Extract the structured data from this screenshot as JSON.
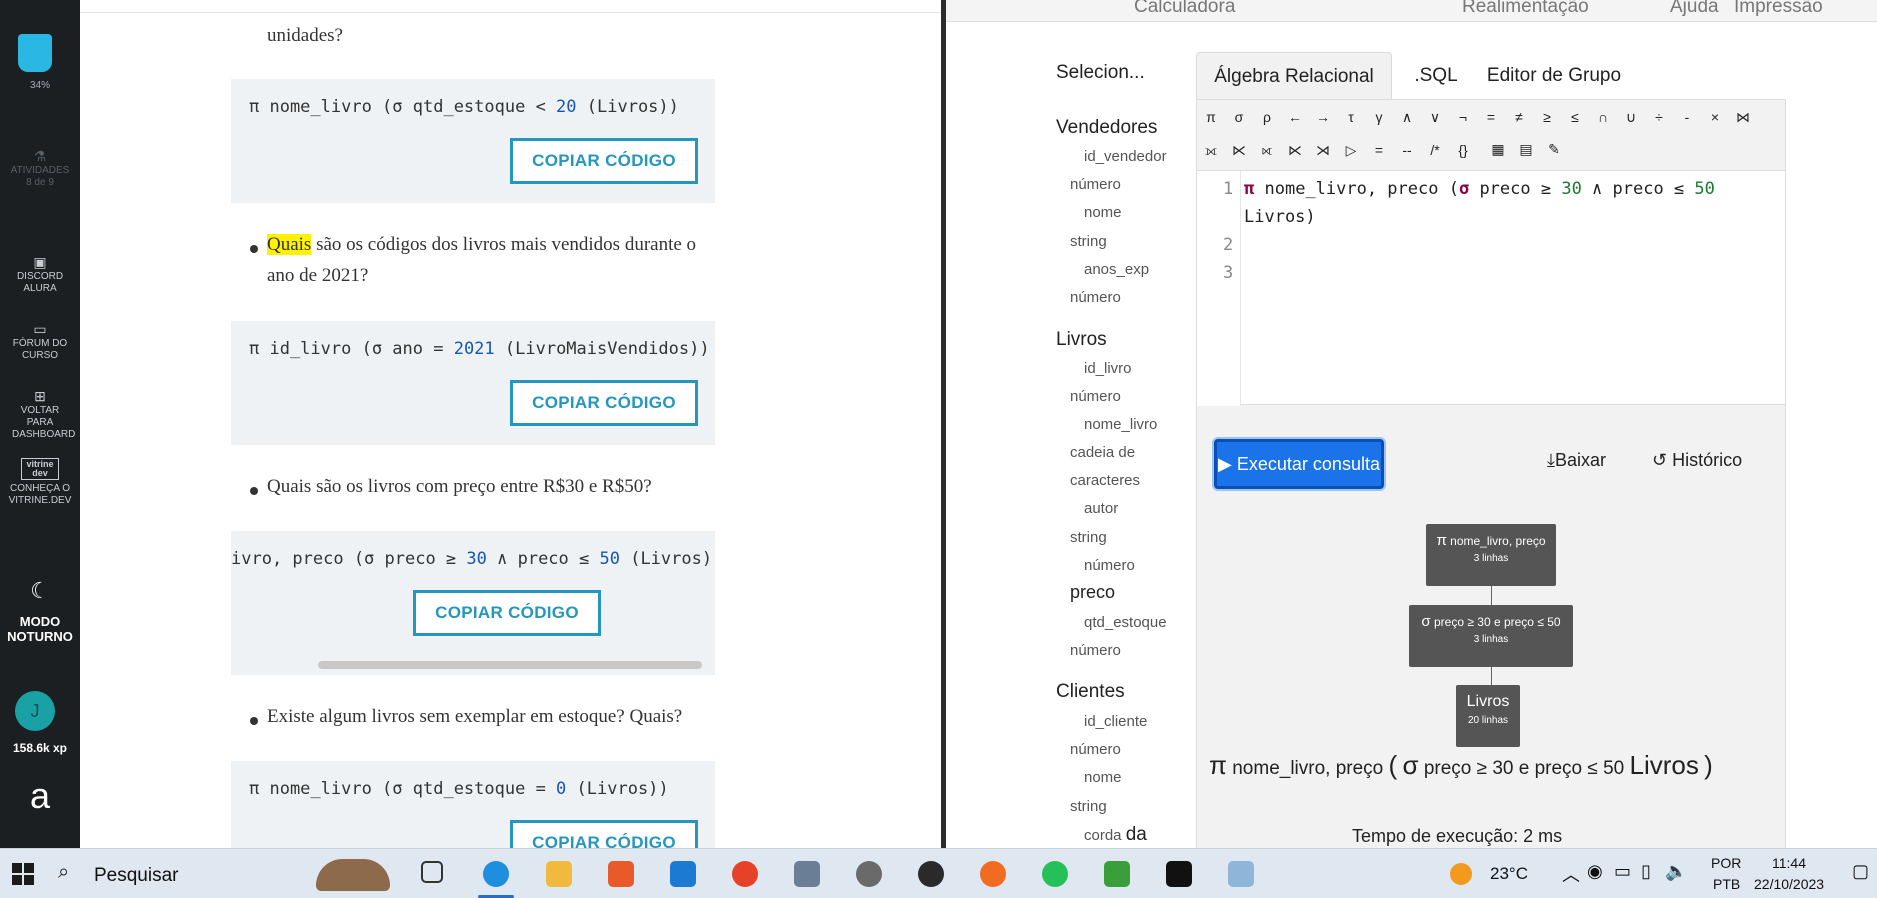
{
  "rail": {
    "progress": "34%",
    "activities_label": "ATIVIDADES",
    "activities_count": "8 de 9",
    "discord_label": "DISCORD ALURA",
    "forum_label": "FÓRUM DO CURSO",
    "back_label": "VOLTAR PARA DASHBOARD",
    "vitrine_badge": "vitrine dev",
    "vitrine_label": "CONHEÇA O VITRINE.DEV",
    "night_mode": "MODO NOTURNO",
    "avatar_letter": "J",
    "xp": "158.6k xp",
    "logo": "a"
  },
  "article": {
    "q0_tail": "unidades?",
    "code1": "π nome_livro (σ qtd_estoque < 20 (Livros))",
    "code1_a": "π nome_livro (σ qtd_estoque < ",
    "code1_num": "20",
    "code1_b": " (Livros))",
    "copy_label": "COPIAR CÓDIGO",
    "q1_hl": "Quais",
    "q1_rest": " são os códigos dos livros mais vendidos durante o",
    "q1_line2": "ano de 2021?",
    "code2_a": "π id_livro (σ ano = ",
    "code2_num": "2021",
    "code2_b": " (LivroMaisVendidos))",
    "q2": "Quais são os livros com preço entre R$30 e R$50?",
    "code3_a": "ivro, preco (σ preco ≥ ",
    "code3_n1": "30",
    "code3_m": " ∧ preco ≤ ",
    "code3_n2": "50",
    "code3_b": " (Livros))",
    "q3": "Existe algum livros sem exemplar em estoque? Quais?",
    "code4_a": "π nome_livro (σ qtd_estoque = ",
    "code4_num": "0",
    "code4_b": " (Livros))"
  },
  "calc": {
    "topnav": [
      "Calculadora",
      "Realimentação",
      "Ajuda",
      "Impressão"
    ],
    "sidebar_title": "Selecion...",
    "tables": {
      "vendedores": "Vendedores",
      "livros": "Livros",
      "clientes": "Clientes"
    },
    "attrs": {
      "id_vendedor": "id_vendedor",
      "numero": "número",
      "nome": "nome",
      "string": "string",
      "anos_exp": "anos_exp",
      "id_livro": "id_livro",
      "nome_livro": "nome_livro",
      "cadeia": "cadeia de",
      "caracteres": "caracteres",
      "autor": "autor",
      "preco": "preco",
      "qtd_estoque": "qtd_estoque",
      "id_cliente": "id_cliente",
      "corda": "corda",
      "da": "da"
    },
    "tabs": [
      "Álgebra Relacional",
      ".SQL",
      "Editor de Grupo"
    ],
    "toolbar_row1": [
      "π",
      "σ",
      "ρ",
      "←",
      "→",
      "τ",
      "γ",
      "∧",
      "∨",
      "¬",
      "=",
      "≠",
      "≥",
      "≤",
      "∩",
      "∪",
      "÷",
      "-",
      "×",
      "⋈"
    ],
    "toolbar_row2": [
      "⟗",
      "⋉",
      "⟖",
      "⋉",
      "⋊",
      "▷",
      "=",
      "--",
      "/*",
      "{}"
    ],
    "line_numbers": [
      "1",
      "2",
      "3"
    ],
    "query": {
      "pi": "π",
      "part1": " nome_livro, preco (",
      "sigma": "σ",
      "part2": " preco ≥ ",
      "n1": "30",
      "part3": " ∧ preco ≤ ",
      "n2": "50",
      "line2": "Livros)"
    },
    "run_label": "Executar consulta",
    "download_label": "Baixar",
    "history_label": "Histórico",
    "tree": {
      "n1_sym": "π",
      "n1_title": "nome_livro, preço",
      "n1_rows": "3 linhas",
      "n2_sym": "σ",
      "n2_title": "preço ≥ 30 e preço ≤ 50",
      "n2_rows": "3 linhas",
      "n3_title": "Livros",
      "n3_rows": "20 linhas"
    },
    "result_expr": {
      "pi": "π",
      "proj": "nome_livro, preço",
      "open": "(",
      "sigma": "σ",
      "cond": "preço ≥ 30 e preço ≤ 50",
      "rel": "Livros",
      "close": ")"
    },
    "exec_time": "Tempo de execução: 2 ms"
  },
  "taskbar": {
    "search": "Pesquisar",
    "weather": "23°C",
    "lang1": "POR",
    "lang2": "PTB",
    "time": "11:44",
    "date": "22/10/2023"
  }
}
